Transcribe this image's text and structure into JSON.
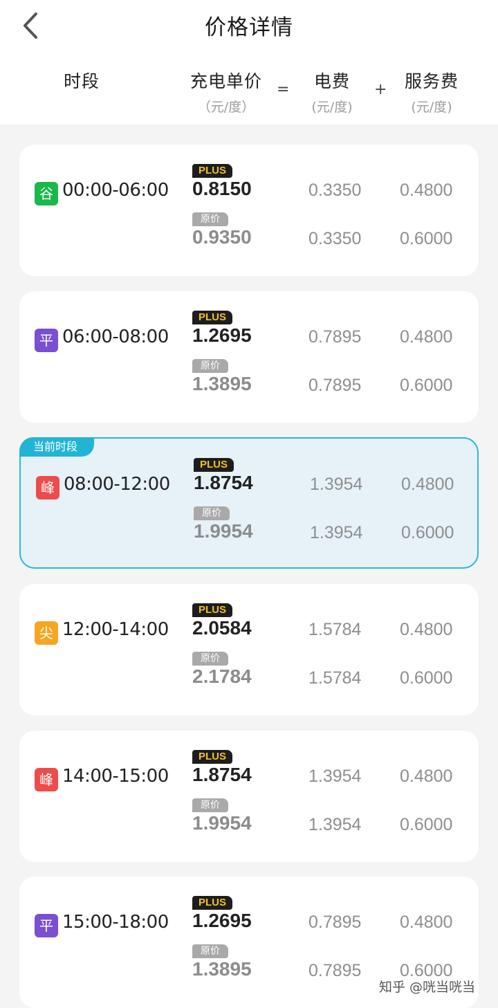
{
  "header": {
    "title": "价格详情",
    "columns": {
      "period": "时段",
      "unit_price": "充电单价",
      "unit_price_unit": "（元/度）",
      "equals": "=",
      "electricity": "电费",
      "electricity_unit": "(元/度)",
      "plus": "+",
      "service": "服务费",
      "service_unit": "(元/度)"
    }
  },
  "labels": {
    "plus_tag": "PLUS",
    "original_tag": "原价",
    "current_tag": "当前时段"
  },
  "periods": [
    {
      "type": "谷",
      "color": "#19b84a",
      "time": "00:00-06:00",
      "plus_price": "0.8150",
      "orig_price": "0.9350",
      "plus_ele": "0.3350",
      "plus_svc": "0.4800",
      "orig_ele": "0.3350",
      "orig_svc": "0.6000",
      "current": false
    },
    {
      "type": "平",
      "color": "#7a4fd0",
      "time": "06:00-08:00",
      "plus_price": "1.2695",
      "orig_price": "1.3895",
      "plus_ele": "0.7895",
      "plus_svc": "0.4800",
      "orig_ele": "0.7895",
      "orig_svc": "0.6000",
      "current": false
    },
    {
      "type": "峰",
      "color": "#ee4b4b",
      "time": "08:00-12:00",
      "plus_price": "1.8754",
      "orig_price": "1.9954",
      "plus_ele": "1.3954",
      "plus_svc": "0.4800",
      "orig_ele": "1.3954",
      "orig_svc": "0.6000",
      "current": true
    },
    {
      "type": "尖",
      "color": "#f5a623",
      "time": "12:00-14:00",
      "plus_price": "2.0584",
      "orig_price": "2.1784",
      "plus_ele": "1.5784",
      "plus_svc": "0.4800",
      "orig_ele": "1.5784",
      "orig_svc": "0.6000",
      "current": false
    },
    {
      "type": "峰",
      "color": "#ee4b4b",
      "time": "14:00-15:00",
      "plus_price": "1.8754",
      "orig_price": "1.9954",
      "plus_ele": "1.3954",
      "plus_svc": "0.4800",
      "orig_ele": "1.3954",
      "orig_svc": "0.6000",
      "current": false
    },
    {
      "type": "平",
      "color": "#7a4fd0",
      "time": "15:00-18:00",
      "plus_price": "1.2695",
      "orig_price": "1.3895",
      "plus_ele": "0.7895",
      "plus_svc": "0.4800",
      "orig_ele": "0.7895",
      "orig_svc": "0.6000",
      "current": false
    }
  ],
  "watermark": "知乎 @咣当咣当"
}
